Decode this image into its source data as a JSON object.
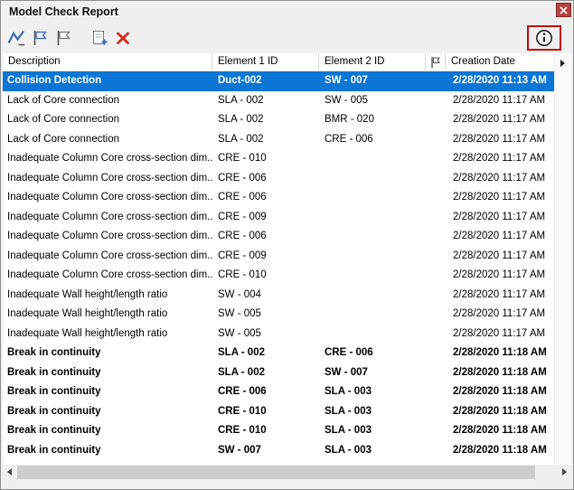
{
  "colors": {
    "selection": "#0b76d4",
    "annotation": "#c40a0a",
    "close_button": "#bc4141",
    "delete_icon": "#d42a1e",
    "icon_blue": "#3a6db5"
  },
  "window": {
    "title": "Model Check Report"
  },
  "icons": {
    "close": "close-icon",
    "toolbar": [
      "model-check-icon",
      "flag-mark-icon",
      "flag-unmark-icon",
      "add-report-icon",
      "delete-icon"
    ],
    "info": "info-icon",
    "flag_column": "flag-icon",
    "vertical_scroll": "scroll-more-arrow",
    "horizontal_scroll": [
      "scroll-left-arrow",
      "scroll-right-arrow"
    ]
  },
  "table": {
    "columns": [
      {
        "label": "Description"
      },
      {
        "label": "Element 1 ID"
      },
      {
        "label": "Element 2 ID"
      },
      {
        "label": "",
        "icon": "flag-icon"
      },
      {
        "label": "Creation Date"
      }
    ],
    "rows": [
      {
        "description": "Collision Detection",
        "el1": "Duct-002",
        "el2": "SW - 007",
        "flag": "",
        "date": "2/28/2020 11:13 AM",
        "selected": true,
        "bold": true
      },
      {
        "description": "Lack of Core connection",
        "el1": "SLA - 002",
        "el2": "SW - 005",
        "flag": "",
        "date": "2/28/2020 11:17 AM",
        "selected": false,
        "bold": false
      },
      {
        "description": "Lack of Core connection",
        "el1": "SLA - 002",
        "el2": "BMR - 020",
        "flag": "",
        "date": "2/28/2020 11:17 AM",
        "selected": false,
        "bold": false
      },
      {
        "description": "Lack of Core connection",
        "el1": "SLA - 002",
        "el2": "CRE - 006",
        "flag": "",
        "date": "2/28/2020 11:17 AM",
        "selected": false,
        "bold": false
      },
      {
        "description": "Inadequate Column Core cross-section dim...",
        "el1": "CRE - 010",
        "el2": "",
        "flag": "",
        "date": "2/28/2020 11:17 AM",
        "selected": false,
        "bold": false
      },
      {
        "description": "Inadequate Column Core cross-section dim...",
        "el1": "CRE - 006",
        "el2": "",
        "flag": "",
        "date": "2/28/2020 11:17 AM",
        "selected": false,
        "bold": false
      },
      {
        "description": "Inadequate Column Core cross-section dim...",
        "el1": "CRE - 006",
        "el2": "",
        "flag": "",
        "date": "2/28/2020 11:17 AM",
        "selected": false,
        "bold": false
      },
      {
        "description": "Inadequate Column Core cross-section dim...",
        "el1": "CRE - 009",
        "el2": "",
        "flag": "",
        "date": "2/28/2020 11:17 AM",
        "selected": false,
        "bold": false
      },
      {
        "description": "Inadequate Column Core cross-section dim...",
        "el1": "CRE - 006",
        "el2": "",
        "flag": "",
        "date": "2/28/2020 11:17 AM",
        "selected": false,
        "bold": false
      },
      {
        "description": "Inadequate Column Core cross-section dim...",
        "el1": "CRE - 009",
        "el2": "",
        "flag": "",
        "date": "2/28/2020 11:17 AM",
        "selected": false,
        "bold": false
      },
      {
        "description": "Inadequate Column Core cross-section dim...",
        "el1": "CRE - 010",
        "el2": "",
        "flag": "",
        "date": "2/28/2020 11:17 AM",
        "selected": false,
        "bold": false
      },
      {
        "description": "Inadequate Wall height/length ratio",
        "el1": "SW - 004",
        "el2": "",
        "flag": "",
        "date": "2/28/2020 11:17 AM",
        "selected": false,
        "bold": false
      },
      {
        "description": "Inadequate Wall height/length ratio",
        "el1": "SW - 005",
        "el2": "",
        "flag": "",
        "date": "2/28/2020 11:17 AM",
        "selected": false,
        "bold": false
      },
      {
        "description": "Inadequate Wall height/length ratio",
        "el1": "SW - 005",
        "el2": "",
        "flag": "",
        "date": "2/28/2020 11:17 AM",
        "selected": false,
        "bold": false
      },
      {
        "description": "Break in continuity",
        "el1": "SLA - 002",
        "el2": "CRE - 006",
        "flag": "",
        "date": "2/28/2020 11:18 AM",
        "selected": false,
        "bold": true
      },
      {
        "description": "Break in continuity",
        "el1": "SLA - 002",
        "el2": "SW - 007",
        "flag": "",
        "date": "2/28/2020 11:18 AM",
        "selected": false,
        "bold": true
      },
      {
        "description": "Break in continuity",
        "el1": "CRE - 006",
        "el2": "SLA - 003",
        "flag": "",
        "date": "2/28/2020 11:18 AM",
        "selected": false,
        "bold": true
      },
      {
        "description": "Break in continuity",
        "el1": "CRE - 010",
        "el2": "SLA - 003",
        "flag": "",
        "date": "2/28/2020 11:18 AM",
        "selected": false,
        "bold": true
      },
      {
        "description": "Break in continuity",
        "el1": "CRE - 010",
        "el2": "SLA - 003",
        "flag": "",
        "date": "2/28/2020 11:18 AM",
        "selected": false,
        "bold": true
      },
      {
        "description": "Break in continuity",
        "el1": "SW - 007",
        "el2": "SLA - 003",
        "flag": "",
        "date": "2/28/2020 11:18 AM",
        "selected": false,
        "bold": true
      }
    ]
  }
}
